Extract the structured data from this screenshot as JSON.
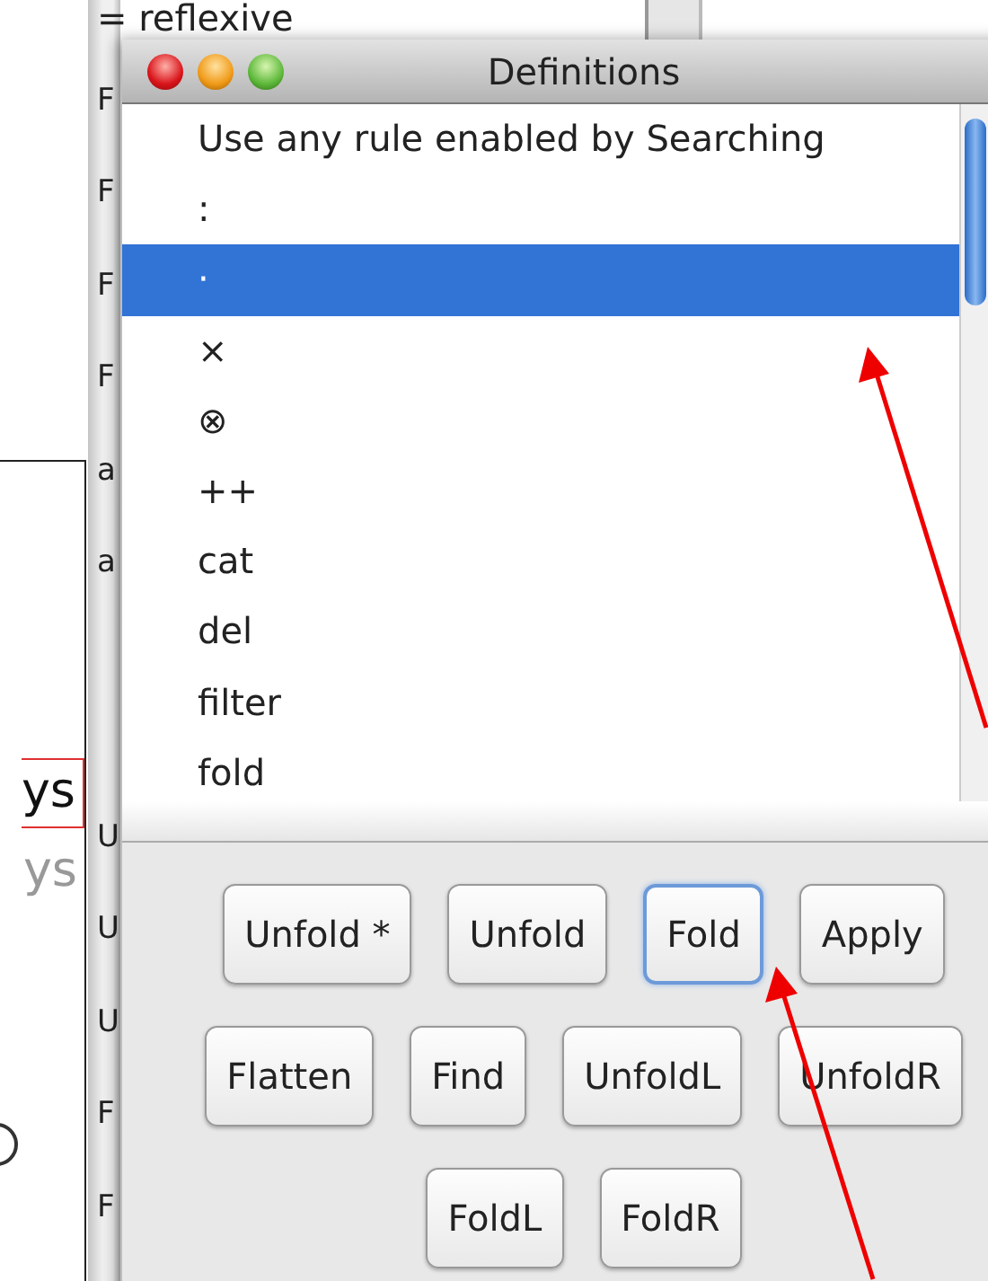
{
  "background_window": {
    "top_text": "= reflexive",
    "column_upper": [
      "F",
      "F",
      "F",
      "F",
      "a",
      "a"
    ],
    "column_lower": [
      "U",
      "U",
      "U",
      "F",
      "F"
    ],
    "side_panel": {
      "highlighted_text": "ys",
      "dim_text": "ys"
    }
  },
  "dialog": {
    "title": "Definitions",
    "items": [
      {
        "label": "Use any rule enabled by Searching",
        "selected": false
      },
      {
        "label": ":",
        "selected": false
      },
      {
        "label": "·",
        "selected": true
      },
      {
        "label": "×",
        "selected": false
      },
      {
        "label": "⊗",
        "selected": false
      },
      {
        "label": "++",
        "selected": false
      },
      {
        "label": "cat",
        "selected": false
      },
      {
        "label": "del",
        "selected": false
      },
      {
        "label": "filter",
        "selected": false
      },
      {
        "label": "fold",
        "selected": false
      }
    ],
    "button_rows": [
      [
        {
          "label": "Unfold *",
          "focused": false
        },
        {
          "label": "Unfold",
          "focused": false
        },
        {
          "label": "Fold",
          "focused": true
        },
        {
          "label": "Apply",
          "focused": false
        }
      ],
      [
        {
          "label": "Flatten",
          "focused": false
        },
        {
          "label": "Find",
          "focused": false
        },
        {
          "label": "UnfoldL",
          "focused": false
        },
        {
          "label": "UnfoldR",
          "focused": false
        }
      ],
      [
        {
          "label": "FoldL",
          "focused": false
        },
        {
          "label": "FoldR",
          "focused": false
        }
      ]
    ]
  }
}
